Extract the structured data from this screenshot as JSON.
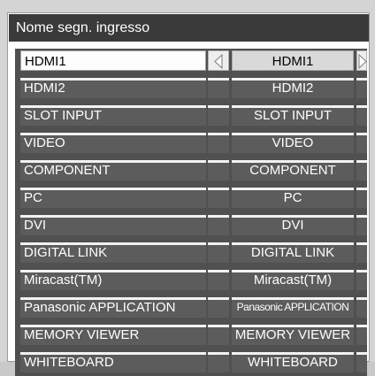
{
  "window": {
    "title": "Nome segn. ingresso"
  },
  "rows": [
    {
      "label": "HDMI1",
      "value": "HDMI1",
      "selected": true
    },
    {
      "label": "HDMI2",
      "value": "HDMI2"
    },
    {
      "label": "SLOT INPUT",
      "value": "SLOT INPUT"
    },
    {
      "label": "VIDEO",
      "value": "VIDEO"
    },
    {
      "label": "COMPONENT",
      "value": "COMPONENT"
    },
    {
      "label": "PC",
      "value": "PC"
    },
    {
      "label": "DVI",
      "value": "DVI"
    },
    {
      "label": "DIGITAL LINK",
      "value": "DIGITAL LINK"
    },
    {
      "label": "Miracast(TM)",
      "value": "Miracast(TM)"
    },
    {
      "label": "Panasonic APPLICATION",
      "value": "Panasonic APPLICATION"
    },
    {
      "label": "MEMORY VIEWER",
      "value": "MEMORY VIEWER"
    },
    {
      "label": "WHITEBOARD",
      "value": "WHITEBOARD"
    }
  ],
  "icons": {
    "left": "triangle-left-icon",
    "right": "triangle-right-icon"
  },
  "colors": {
    "title_bg": "#3a3a3a",
    "row_bg": "#5c5c5c",
    "selected_bg": "#fdfdfd",
    "highlight": "#f2f2f2"
  }
}
